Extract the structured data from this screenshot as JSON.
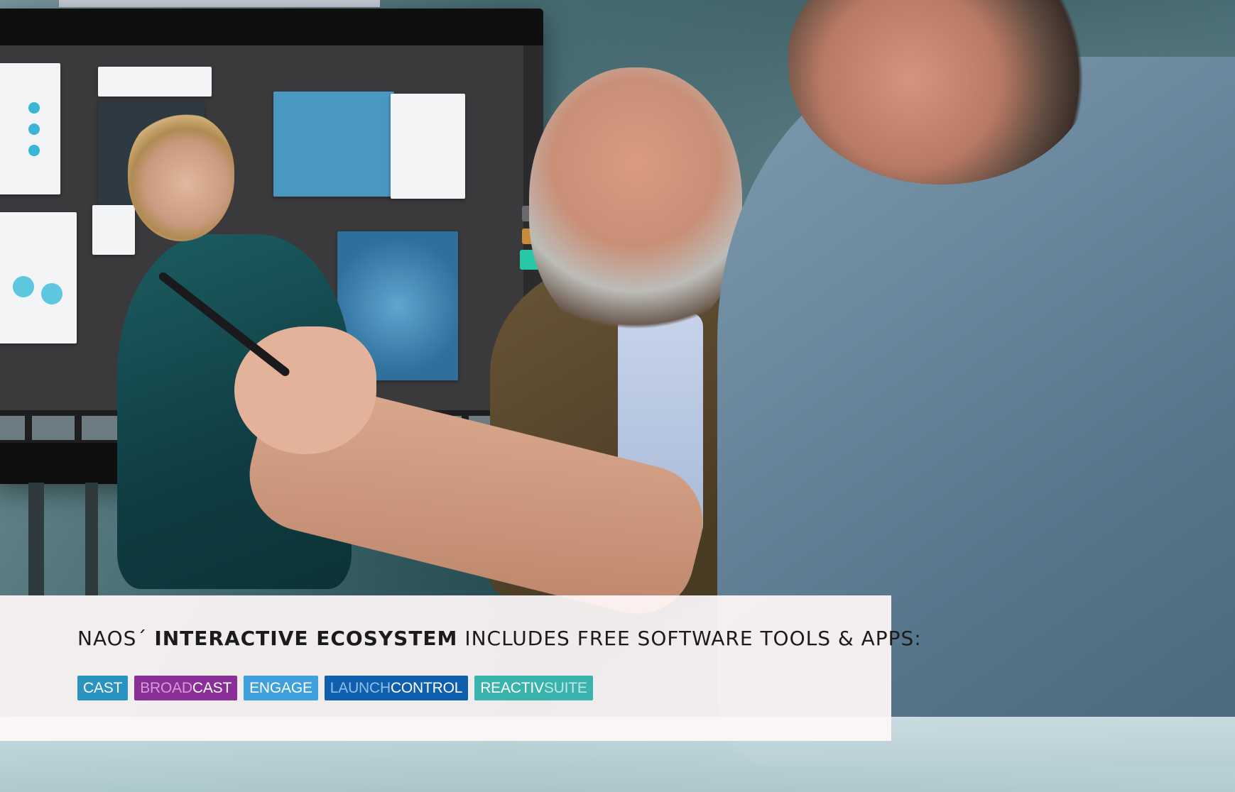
{
  "headline": {
    "prefix": "NAOS´ ",
    "emphasis": "INTERACTIVE ECOSYSTEM",
    "suffix": " INCLUDES FREE SOFTWARE TOOLS & APPS:"
  },
  "apps": [
    {
      "name": "cast",
      "part1": "CAST",
      "part2": "",
      "bg": "#2a93c0",
      "color1": "#ffffff",
      "color2": "#ffffff"
    },
    {
      "name": "broadcast",
      "part1": "BROAD",
      "part2": "CAST",
      "bg": "#8a2f97",
      "color1": "#d79ad9",
      "color2": "#ffffff"
    },
    {
      "name": "engage",
      "part1": "ENGAGE",
      "part2": "",
      "bg": "#3ea0dc",
      "color1": "#ffffff",
      "color2": "#ffffff"
    },
    {
      "name": "launch-control",
      "part1": "LAUNCH ",
      "part2": "CONTROL",
      "bg": "#0f5fae",
      "color1": "#8ec0ec",
      "color2": "#ffffff"
    },
    {
      "name": "reactiv-suite",
      "part1": "REACTIV ",
      "part2": "SUITE",
      "bg": "#3bb3ad",
      "color1": "#ffffff",
      "color2": "#bfe9e4"
    }
  ]
}
